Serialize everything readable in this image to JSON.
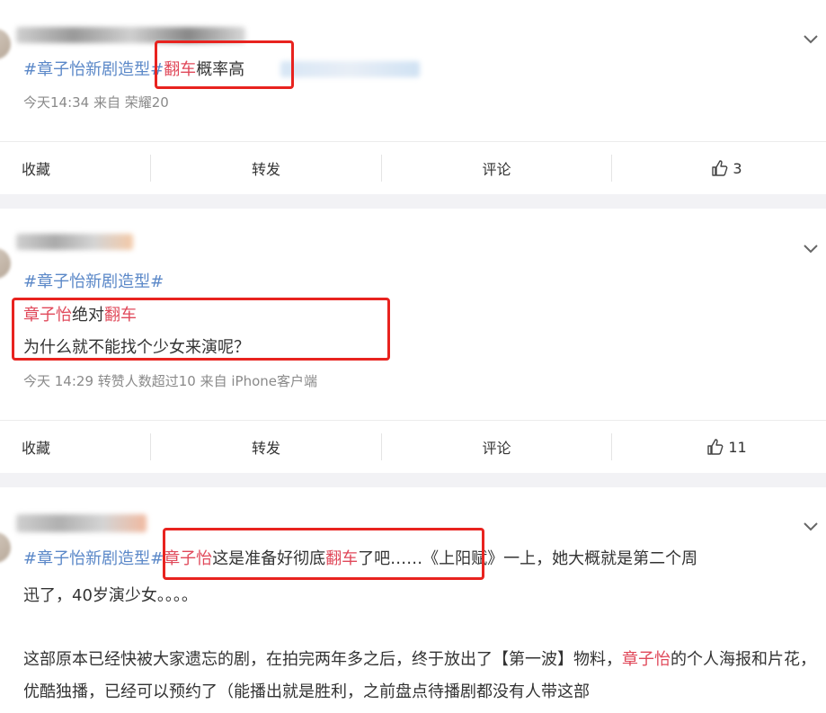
{
  "labels": {
    "favorite": "收藏",
    "repost": "转发",
    "comment": "评论"
  },
  "posts": [
    {
      "topic": "#章子怡新剧造型",
      "hash": "#",
      "keyword": "翻车",
      "text": "概率高",
      "meta": "今天14:34  来自 荣耀20",
      "likes": "3"
    },
    {
      "topic": "#章子怡新剧造型#",
      "kw1": "章子怡",
      "t1": "绝对",
      "kw2": "翻车",
      "line2": "为什么就不能找个少女来演呢？",
      "meta": "今天 14:29 转赞人数超过10  来自 iPhone客户端",
      "likes": "11"
    },
    {
      "topic": "#章子怡新剧造型",
      "hash": "#",
      "kw1": "章子怡",
      "t1": "这是准备好彻底",
      "kw2": "翻车",
      "t2": "了吧……《上阳赋》一上，她大概就是第二个周",
      "line2": "迅了，40岁演少女。。。。",
      "p1": "这部原本已经快被大家遗忘的剧，在拍完两年多之后，终于放出了【第一波】物料，",
      "p_kw": "章子怡",
      "p2": "的个人海报和片花，优酷独播，已经可以预约了（能播出就是胜利，之前盘点待播剧都没有人带这部"
    }
  ],
  "colors": {
    "topic": "#5b88c8",
    "keyword": "#e0495a",
    "highlight_box": "#e8231f",
    "separator": "#f2f2f5"
  }
}
